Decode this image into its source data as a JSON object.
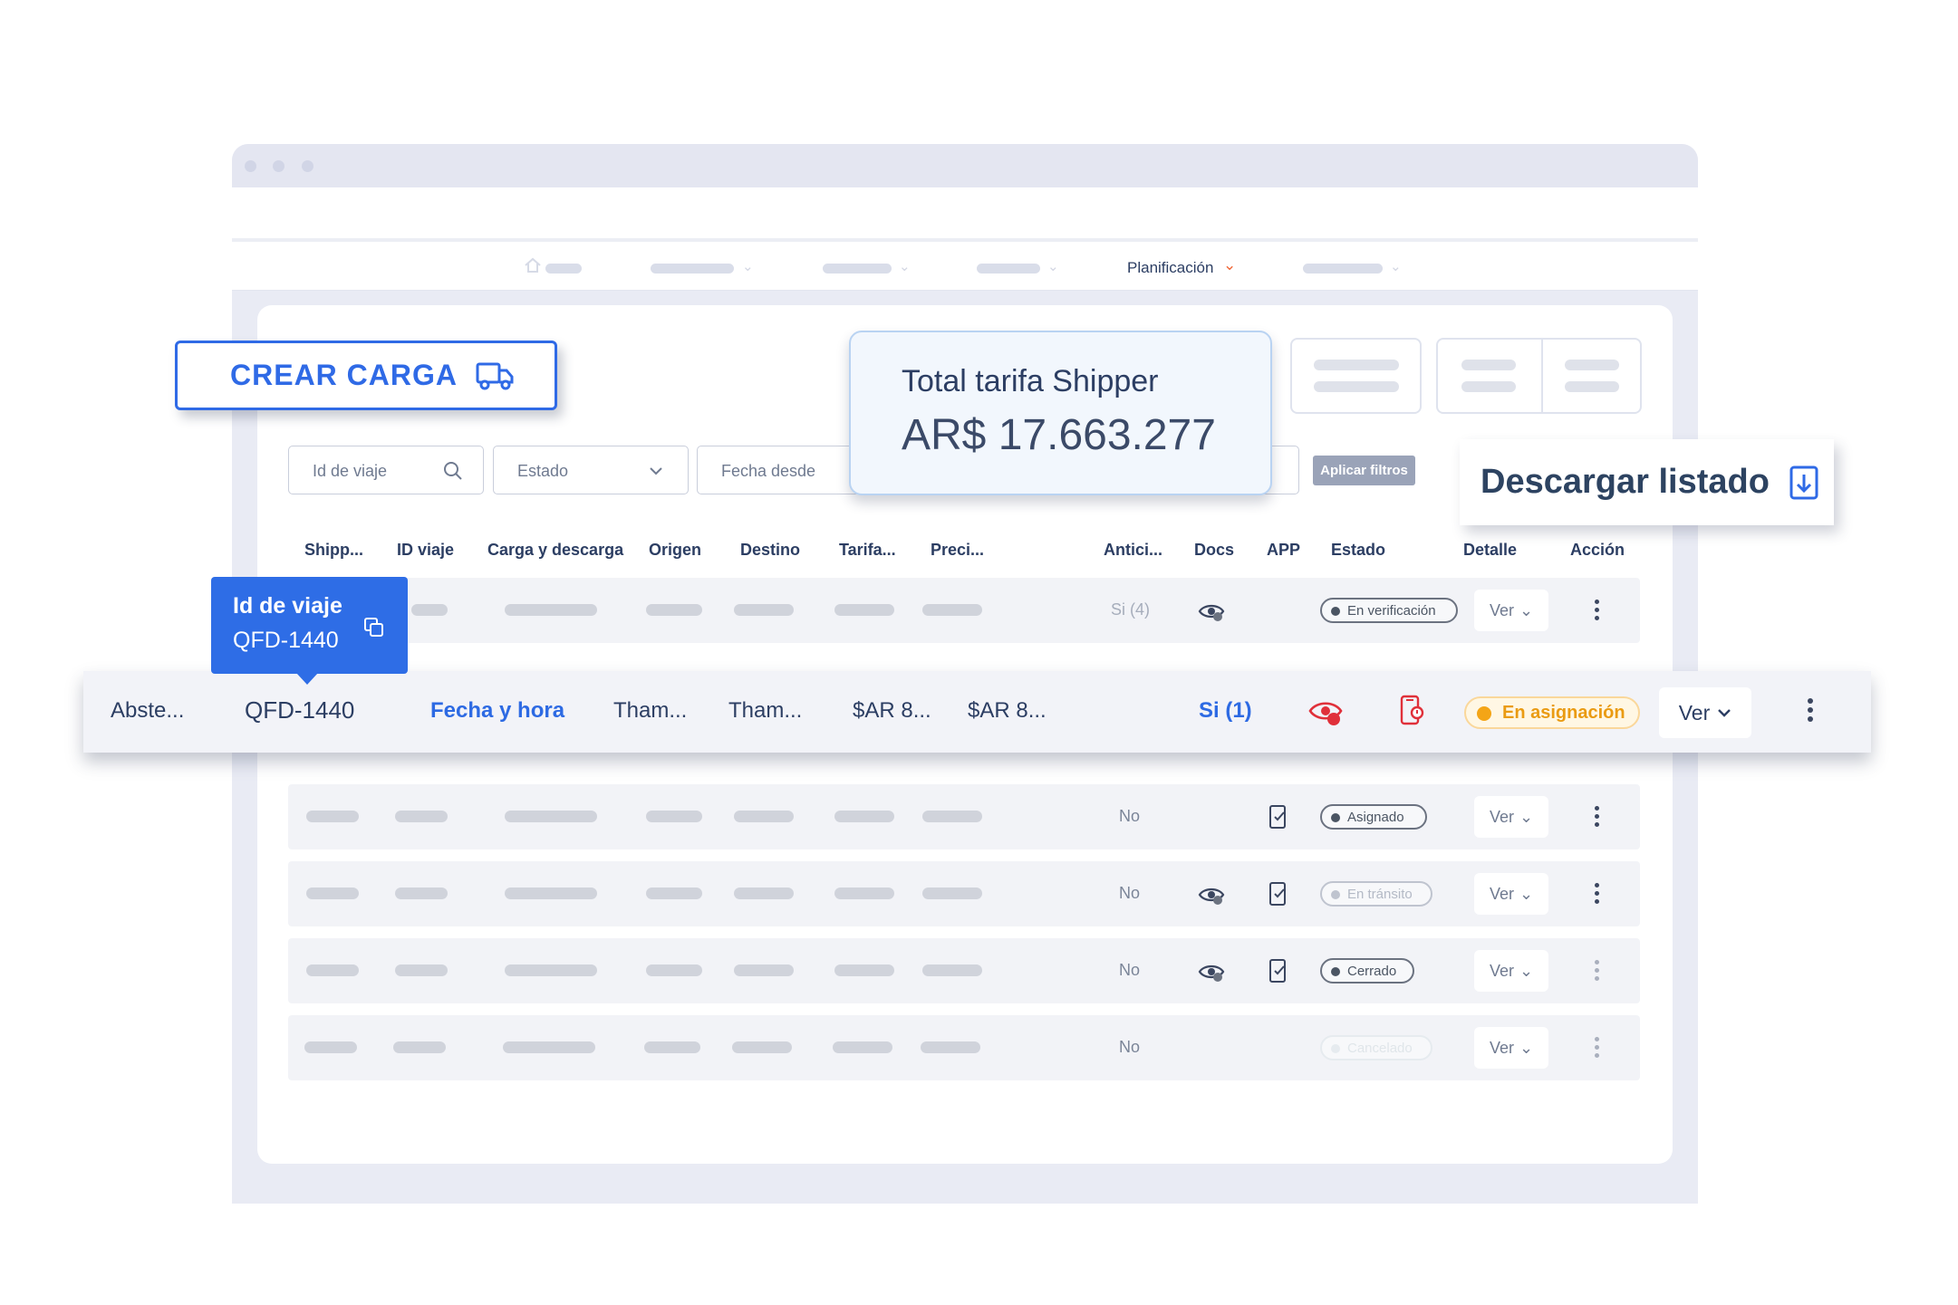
{
  "nav": {
    "active_label": "Planificación"
  },
  "actions": {
    "create_label": "CREAR CARGA",
    "download_label": "Descargar listado"
  },
  "summary": {
    "label": "Total tarifa Shipper",
    "value": "AR$ 17.663.277"
  },
  "filters": {
    "trip_id_placeholder": "Id de viaje",
    "state_placeholder": "Estado",
    "date_from_placeholder": "Fecha desde",
    "apply_label": "Aplicar filtros"
  },
  "table": {
    "headers": [
      "Shipp...",
      "ID viaje",
      "Carga y descarga",
      "Origen",
      "Destino",
      "Tarifa...",
      "Preci...",
      "Antici...",
      "Docs",
      "APP",
      "Estado",
      "Detalle",
      "Acción"
    ],
    "ver_label": "Ver",
    "rows": [
      {
        "advance": "Si (4)",
        "status": "En verificación"
      },
      {
        "advance": "No",
        "status": "Asignado"
      },
      {
        "advance": "No",
        "status": "En tránsito"
      },
      {
        "advance": "No",
        "status": "Cerrado"
      },
      {
        "advance": "No",
        "status": "Cancelado"
      }
    ],
    "highlighted": {
      "shipper": "Abste...",
      "trip_id": "QFD-1440",
      "load_unload": "Fecha y hora",
      "origin": "Tham...",
      "destination": "Tham...",
      "rate": "$AR 8...",
      "price": "$AR 8...",
      "advance": "Si (1)",
      "status": "En asignación",
      "ver_label": "Ver"
    }
  },
  "tooltip": {
    "title": "Id de viaje",
    "value": "QFD-1440"
  },
  "colors": {
    "brand_blue": "#2f6ae6",
    "warning": "#f4a516",
    "alert_red": "#e0303a",
    "text_dark": "#2c3e63"
  }
}
